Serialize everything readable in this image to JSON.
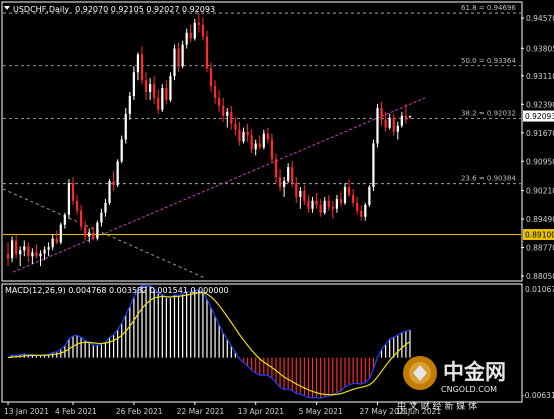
{
  "header": {
    "symbol": "USDCHF,Daily",
    "ohlc": "0.92070 0.92105 0.92027 0.92093"
  },
  "price_axis": {
    "ticks": [
      "0.94570",
      "0.93805",
      "0.93110",
      "0.92390",
      "0.91670",
      "0.90950",
      "0.90210",
      "0.89490",
      "0.88770",
      "0.88050"
    ],
    "current_price": "0.92093",
    "horizontal_line_price": "0.89100"
  },
  "fib_levels": [
    {
      "label": "61.8 = 0.94696",
      "value": 0.94696
    },
    {
      "label": "50.0 = 0.93364",
      "value": 0.93364
    },
    {
      "label": "38.2 = 0.92032",
      "value": 0.92032
    },
    {
      "label": "23.6 = 0.90384",
      "value": 0.90384
    }
  ],
  "macd": {
    "label": "MACD(12,26,9) 0.004768 0.003582 0.001541 0.000000",
    "ticks": [
      "0.01067",
      "-0.006312"
    ]
  },
  "date_axis": [
    "13 Jan 2021",
    "4 Feb 2021",
    "26 Feb 2021",
    "22 Mar 2021",
    "13 Apr 2021",
    "5 May 2021",
    "27 May 2021",
    "18 Jun 2021"
  ],
  "watermark": {
    "brand_cn": "中金网",
    "domain": "CNGOLD.COM",
    "slogan": "中 文 财 经 新 媒 体"
  },
  "colors": {
    "bull_candle": "#ffffff",
    "bear_candle": "#ff2a2a",
    "fib_line": "#bfbfbf",
    "trend_line": "#c040c0",
    "support_line": "#e8c200",
    "macd_signal": "#f0e000",
    "macd_main": "#2040ff"
  },
  "chart_data": {
    "type": "candlestick",
    "symbol": "USDCHF",
    "timeframe": "Daily",
    "ylim": [
      0.8795,
      0.9495
    ],
    "candles": [
      {
        "o": 0.886,
        "h": 0.889,
        "l": 0.883,
        "c": 0.885
      },
      {
        "o": 0.885,
        "h": 0.8905,
        "l": 0.884,
        "c": 0.8895
      },
      {
        "o": 0.8895,
        "h": 0.891,
        "l": 0.885,
        "c": 0.886
      },
      {
        "o": 0.886,
        "h": 0.888,
        "l": 0.883,
        "c": 0.887
      },
      {
        "o": 0.887,
        "h": 0.8895,
        "l": 0.8855,
        "c": 0.888
      },
      {
        "o": 0.888,
        "h": 0.889,
        "l": 0.884,
        "c": 0.8855
      },
      {
        "o": 0.8855,
        "h": 0.8875,
        "l": 0.8835,
        "c": 0.8865
      },
      {
        "o": 0.8865,
        "h": 0.8885,
        "l": 0.885,
        "c": 0.8855
      },
      {
        "o": 0.8855,
        "h": 0.887,
        "l": 0.883,
        "c": 0.8862
      },
      {
        "o": 0.8862,
        "h": 0.888,
        "l": 0.8845,
        "c": 0.8872
      },
      {
        "o": 0.8872,
        "h": 0.889,
        "l": 0.8855,
        "c": 0.8878
      },
      {
        "o": 0.8878,
        "h": 0.891,
        "l": 0.887,
        "c": 0.89
      },
      {
        "o": 0.89,
        "h": 0.892,
        "l": 0.8885,
        "c": 0.889
      },
      {
        "o": 0.889,
        "h": 0.894,
        "l": 0.8885,
        "c": 0.8935
      },
      {
        "o": 0.8935,
        "h": 0.8965,
        "l": 0.8925,
        "c": 0.896
      },
      {
        "o": 0.896,
        "h": 0.905,
        "l": 0.895,
        "c": 0.904
      },
      {
        "o": 0.904,
        "h": 0.9055,
        "l": 0.8985,
        "c": 0.8995
      },
      {
        "o": 0.8995,
        "h": 0.901,
        "l": 0.896,
        "c": 0.897
      },
      {
        "o": 0.897,
        "h": 0.8985,
        "l": 0.892,
        "c": 0.893
      },
      {
        "o": 0.893,
        "h": 0.8945,
        "l": 0.8895,
        "c": 0.8905
      },
      {
        "o": 0.8905,
        "h": 0.8925,
        "l": 0.889,
        "c": 0.8915
      },
      {
        "o": 0.8915,
        "h": 0.893,
        "l": 0.8895,
        "c": 0.89
      },
      {
        "o": 0.89,
        "h": 0.8945,
        "l": 0.8895,
        "c": 0.894
      },
      {
        "o": 0.894,
        "h": 0.8975,
        "l": 0.893,
        "c": 0.8965
      },
      {
        "o": 0.8965,
        "h": 0.9,
        "l": 0.8955,
        "c": 0.899
      },
      {
        "o": 0.899,
        "h": 0.905,
        "l": 0.8985,
        "c": 0.9045
      },
      {
        "o": 0.9045,
        "h": 0.907,
        "l": 0.902,
        "c": 0.9035
      },
      {
        "o": 0.9035,
        "h": 0.91,
        "l": 0.903,
        "c": 0.9095
      },
      {
        "o": 0.9095,
        "h": 0.916,
        "l": 0.909,
        "c": 0.915
      },
      {
        "o": 0.915,
        "h": 0.923,
        "l": 0.914,
        "c": 0.9215
      },
      {
        "o": 0.9215,
        "h": 0.927,
        "l": 0.92,
        "c": 0.926
      },
      {
        "o": 0.926,
        "h": 0.9335,
        "l": 0.925,
        "c": 0.932
      },
      {
        "o": 0.932,
        "h": 0.937,
        "l": 0.93,
        "c": 0.9365
      },
      {
        "o": 0.9365,
        "h": 0.9385,
        "l": 0.929,
        "c": 0.93
      },
      {
        "o": 0.93,
        "h": 0.932,
        "l": 0.925,
        "c": 0.927
      },
      {
        "o": 0.927,
        "h": 0.9305,
        "l": 0.925,
        "c": 0.929
      },
      {
        "o": 0.929,
        "h": 0.931,
        "l": 0.924,
        "c": 0.9255
      },
      {
        "o": 0.9255,
        "h": 0.9275,
        "l": 0.9215,
        "c": 0.9225
      },
      {
        "o": 0.9225,
        "h": 0.929,
        "l": 0.922,
        "c": 0.928
      },
      {
        "o": 0.928,
        "h": 0.93,
        "l": 0.924,
        "c": 0.925
      },
      {
        "o": 0.925,
        "h": 0.932,
        "l": 0.9245,
        "c": 0.931
      },
      {
        "o": 0.931,
        "h": 0.939,
        "l": 0.93,
        "c": 0.938
      },
      {
        "o": 0.938,
        "h": 0.9395,
        "l": 0.932,
        "c": 0.9335
      },
      {
        "o": 0.9335,
        "h": 0.94,
        "l": 0.933,
        "c": 0.939
      },
      {
        "o": 0.939,
        "h": 0.943,
        "l": 0.938,
        "c": 0.942
      },
      {
        "o": 0.942,
        "h": 0.944,
        "l": 0.9395,
        "c": 0.9405
      },
      {
        "o": 0.9405,
        "h": 0.9455,
        "l": 0.94,
        "c": 0.9445
      },
      {
        "o": 0.9445,
        "h": 0.947,
        "l": 0.942,
        "c": 0.944
      },
      {
        "o": 0.944,
        "h": 0.946,
        "l": 0.94,
        "c": 0.941
      },
      {
        "o": 0.941,
        "h": 0.9425,
        "l": 0.932,
        "c": 0.933
      },
      {
        "o": 0.933,
        "h": 0.9345,
        "l": 0.927,
        "c": 0.9285
      },
      {
        "o": 0.9285,
        "h": 0.93,
        "l": 0.924,
        "c": 0.9255
      },
      {
        "o": 0.9255,
        "h": 0.9275,
        "l": 0.922,
        "c": 0.9235
      },
      {
        "o": 0.9235,
        "h": 0.9255,
        "l": 0.9195,
        "c": 0.921
      },
      {
        "o": 0.921,
        "h": 0.923,
        "l": 0.918,
        "c": 0.922
      },
      {
        "o": 0.922,
        "h": 0.9235,
        "l": 0.9175,
        "c": 0.919
      },
      {
        "o": 0.919,
        "h": 0.9205,
        "l": 0.916,
        "c": 0.9175
      },
      {
        "o": 0.9175,
        "h": 0.9195,
        "l": 0.9135,
        "c": 0.9145
      },
      {
        "o": 0.9145,
        "h": 0.918,
        "l": 0.914,
        "c": 0.917
      },
      {
        "o": 0.917,
        "h": 0.919,
        "l": 0.9145,
        "c": 0.916
      },
      {
        "o": 0.916,
        "h": 0.9175,
        "l": 0.9115,
        "c": 0.9125
      },
      {
        "o": 0.9125,
        "h": 0.915,
        "l": 0.911,
        "c": 0.914
      },
      {
        "o": 0.914,
        "h": 0.916,
        "l": 0.9125,
        "c": 0.913
      },
      {
        "o": 0.913,
        "h": 0.9175,
        "l": 0.9125,
        "c": 0.9165
      },
      {
        "o": 0.9165,
        "h": 0.918,
        "l": 0.914,
        "c": 0.915
      },
      {
        "o": 0.915,
        "h": 0.9165,
        "l": 0.909,
        "c": 0.91
      },
      {
        "o": 0.91,
        "h": 0.9115,
        "l": 0.904,
        "c": 0.9055
      },
      {
        "o": 0.9055,
        "h": 0.9075,
        "l": 0.902,
        "c": 0.903
      },
      {
        "o": 0.903,
        "h": 0.9055,
        "l": 0.9005,
        "c": 0.9045
      },
      {
        "o": 0.9045,
        "h": 0.909,
        "l": 0.904,
        "c": 0.908
      },
      {
        "o": 0.908,
        "h": 0.9095,
        "l": 0.903,
        "c": 0.904
      },
      {
        "o": 0.904,
        "h": 0.9055,
        "l": 0.899,
        "c": 0.9005
      },
      {
        "o": 0.9005,
        "h": 0.903,
        "l": 0.8975,
        "c": 0.902
      },
      {
        "o": 0.902,
        "h": 0.9035,
        "l": 0.8985,
        "c": 0.8995
      },
      {
        "o": 0.8995,
        "h": 0.901,
        "l": 0.8965,
        "c": 0.8975
      },
      {
        "o": 0.8975,
        "h": 0.9005,
        "l": 0.8965,
        "c": 0.8995
      },
      {
        "o": 0.8995,
        "h": 0.9015,
        "l": 0.8975,
        "c": 0.8985
      },
      {
        "o": 0.8985,
        "h": 0.9,
        "l": 0.8955,
        "c": 0.8965
      },
      {
        "o": 0.8965,
        "h": 0.9005,
        "l": 0.896,
        "c": 0.8995
      },
      {
        "o": 0.8995,
        "h": 0.901,
        "l": 0.897,
        "c": 0.898
      },
      {
        "o": 0.898,
        "h": 0.8995,
        "l": 0.895,
        "c": 0.8975
      },
      {
        "o": 0.8975,
        "h": 0.901,
        "l": 0.8965,
        "c": 0.9
      },
      {
        "o": 0.9,
        "h": 0.902,
        "l": 0.898,
        "c": 0.899
      },
      {
        "o": 0.899,
        "h": 0.904,
        "l": 0.8985,
        "c": 0.903
      },
      {
        "o": 0.903,
        "h": 0.905,
        "l": 0.9005,
        "c": 0.901
      },
      {
        "o": 0.901,
        "h": 0.9025,
        "l": 0.898,
        "c": 0.899
      },
      {
        "o": 0.899,
        "h": 0.9005,
        "l": 0.896,
        "c": 0.897
      },
      {
        "o": 0.897,
        "h": 0.8985,
        "l": 0.8945,
        "c": 0.8955
      },
      {
        "o": 0.8955,
        "h": 0.899,
        "l": 0.8945,
        "c": 0.8985
      },
      {
        "o": 0.8985,
        "h": 0.9035,
        "l": 0.898,
        "c": 0.903
      },
      {
        "o": 0.903,
        "h": 0.915,
        "l": 0.902,
        "c": 0.914
      },
      {
        "o": 0.914,
        "h": 0.924,
        "l": 0.913,
        "c": 0.923
      },
      {
        "o": 0.923,
        "h": 0.9245,
        "l": 0.9185,
        "c": 0.92
      },
      {
        "o": 0.92,
        "h": 0.922,
        "l": 0.917,
        "c": 0.918
      },
      {
        "o": 0.918,
        "h": 0.9215,
        "l": 0.9175,
        "c": 0.9205
      },
      {
        "o": 0.9205,
        "h": 0.9215,
        "l": 0.916,
        "c": 0.917
      },
      {
        "o": 0.917,
        "h": 0.9195,
        "l": 0.915,
        "c": 0.9185
      },
      {
        "o": 0.9185,
        "h": 0.922,
        "l": 0.918,
        "c": 0.921
      },
      {
        "o": 0.921,
        "h": 0.924,
        "l": 0.919,
        "c": 0.92
      },
      {
        "o": 0.9207,
        "h": 0.92105,
        "l": 0.92027,
        "c": 0.92093
      }
    ]
  }
}
